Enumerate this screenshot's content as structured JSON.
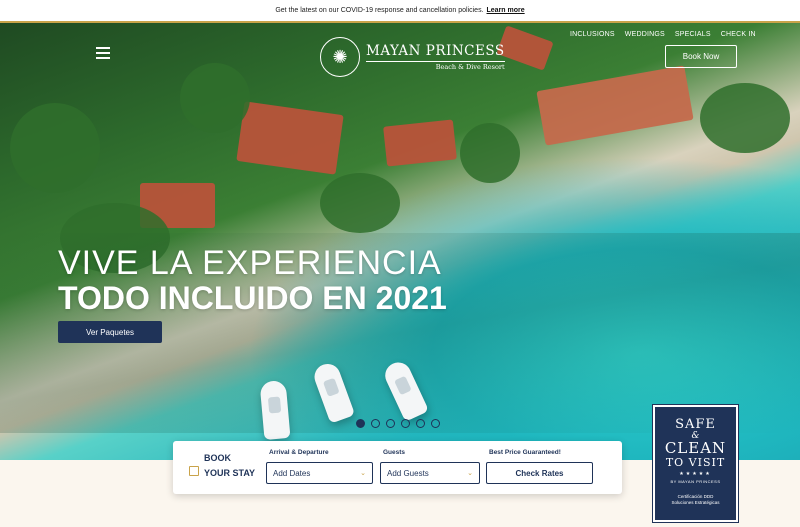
{
  "topbar": {
    "text": "Get the latest on our COVID-19 response and cancellation policies.",
    "link": "Learn more"
  },
  "logo": {
    "name": "MAYAN PRINCESS",
    "tagline": "Beach & Dive Resort"
  },
  "nav": {
    "items": [
      "INCLUSIONS",
      "WEDDINGS",
      "SPECIALS",
      "CHECK IN"
    ]
  },
  "header": {
    "book_now": "Book Now"
  },
  "hero": {
    "line1": "VIVE LA EXPERIENCIA",
    "line2": "TODO INCLUIDO EN 2021",
    "cta": "Ver Paquetes",
    "slides": 6,
    "active_slide": 1
  },
  "booking": {
    "title_line1": "BOOK",
    "title_line2": "YOUR STAY",
    "arrival_label": "Arrival & Departure",
    "arrival_value": "Add Dates",
    "guests_label": "Guests",
    "guests_value": "Add Guests",
    "price_label": "Best Price Guaranteed!",
    "check_rates": "Check Rates"
  },
  "badge": {
    "line1": "SAFE",
    "amp": "&",
    "line2": "CLEAN",
    "line3": "TO VISIT",
    "stars": "★★★★★",
    "by": "BY MAYAN PRINCESS",
    "cert_line1": "Certificación DDD",
    "cert_line2": "Soluciones Estratégicas"
  },
  "colors": {
    "navy": "#1f3358",
    "gold": "#c9a34a",
    "cream": "#fbf6ee"
  }
}
